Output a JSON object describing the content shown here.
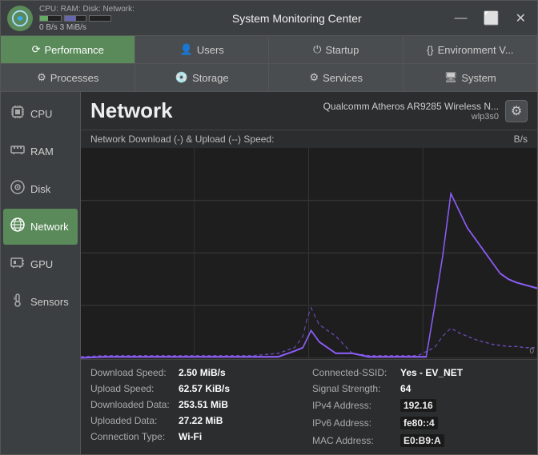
{
  "titlebar": {
    "title": "System Monitoring Center",
    "stats_label": "CPU: RAM: Disk: Network:",
    "stats_values": "0 B/s  3 MiB/s"
  },
  "nav_tabs_row1": [
    {
      "id": "performance",
      "label": "Performance",
      "icon": "⟳",
      "active": true
    },
    {
      "id": "users",
      "label": "Users",
      "icon": "👤",
      "active": false
    },
    {
      "id": "startup",
      "label": "Startup",
      "icon": "⏻",
      "active": false
    },
    {
      "id": "environment",
      "label": "Environment V...",
      "icon": "{}",
      "active": false
    }
  ],
  "nav_tabs_row2": [
    {
      "id": "processes",
      "label": "Processes",
      "icon": "⚙",
      "active": false
    },
    {
      "id": "storage",
      "label": "Storage",
      "icon": "💿",
      "active": false
    },
    {
      "id": "services",
      "label": "Services",
      "icon": "⚙",
      "active": false
    },
    {
      "id": "system",
      "label": "System",
      "icon": "🖥",
      "active": false
    }
  ],
  "sidebar": {
    "items": [
      {
        "id": "cpu",
        "label": "CPU",
        "icon": "cpu",
        "active": false
      },
      {
        "id": "ram",
        "label": "RAM",
        "icon": "ram",
        "active": false
      },
      {
        "id": "disk",
        "label": "Disk",
        "icon": "disk",
        "active": false
      },
      {
        "id": "network",
        "label": "Network",
        "icon": "network",
        "active": true
      },
      {
        "id": "gpu",
        "label": "GPU",
        "icon": "gpu",
        "active": false
      },
      {
        "id": "sensors",
        "label": "Sensors",
        "icon": "sensors",
        "active": false
      }
    ]
  },
  "network": {
    "title": "Network",
    "device_name": "Qualcomm Atheros AR9285 Wireless N...",
    "device_id": "wlp3s0",
    "chart_label": "Network Download (-) & Upload (--) Speed:",
    "chart_unit": "B/s",
    "chart_zero": "0"
  },
  "stats": {
    "left": [
      {
        "label": "Download Speed:",
        "value": "2.50 MiB/s"
      },
      {
        "label": "Upload Speed:",
        "value": "62.57 KiB/s"
      },
      {
        "label": "Downloaded Data:",
        "value": "253.51 MiB"
      },
      {
        "label": "Uploaded Data:",
        "value": "27.22 MiB"
      },
      {
        "label": "Connection Type:",
        "value": "Wi-Fi"
      }
    ],
    "right": [
      {
        "label": "Connected-SSID:",
        "value": "Yes - EV_NET",
        "dark": false
      },
      {
        "label": "Signal Strength:",
        "value": "64",
        "dark": false
      },
      {
        "label": "IPv4 Address:",
        "value": "192.16",
        "dark": true
      },
      {
        "label": "IPv6 Address:",
        "value": "fe80::4",
        "dark": true
      },
      {
        "label": "MAC Address:",
        "value": "E0:B9:A",
        "dark": true
      }
    ]
  },
  "window_controls": {
    "minimize": "—",
    "maximize": "⬜",
    "close": "✕"
  }
}
